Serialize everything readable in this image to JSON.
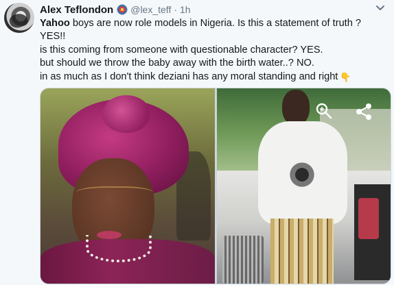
{
  "tweet": {
    "author_name": "Alex Teflondon",
    "handle": "@lex_teff",
    "separator": "·",
    "time": "1h",
    "icons": {
      "avatar": "avatar",
      "badge": "badge-icon",
      "menu": "chevron-down-icon",
      "emoji": "point-down-icon",
      "zoom": "magnify-icon",
      "share": "share-icon"
    },
    "text": {
      "line1_bold": "Yahoo",
      "line1_rest": " boys are now role models in Nigeria. Is this a statement of truth ?",
      "line2": "YES!!",
      "line3": "is this coming from someone with questionable character? YES.",
      "line4": "but should we throw the baby away with the birth water..? NO.",
      "line5": "in as much as I don't think deziani has any moral standing and right"
    },
    "emoji": "👇"
  },
  "colors": {
    "background": "#f5f8fa",
    "text": "#14171a",
    "muted": "#657786",
    "media_border": "#ccd6dd"
  }
}
